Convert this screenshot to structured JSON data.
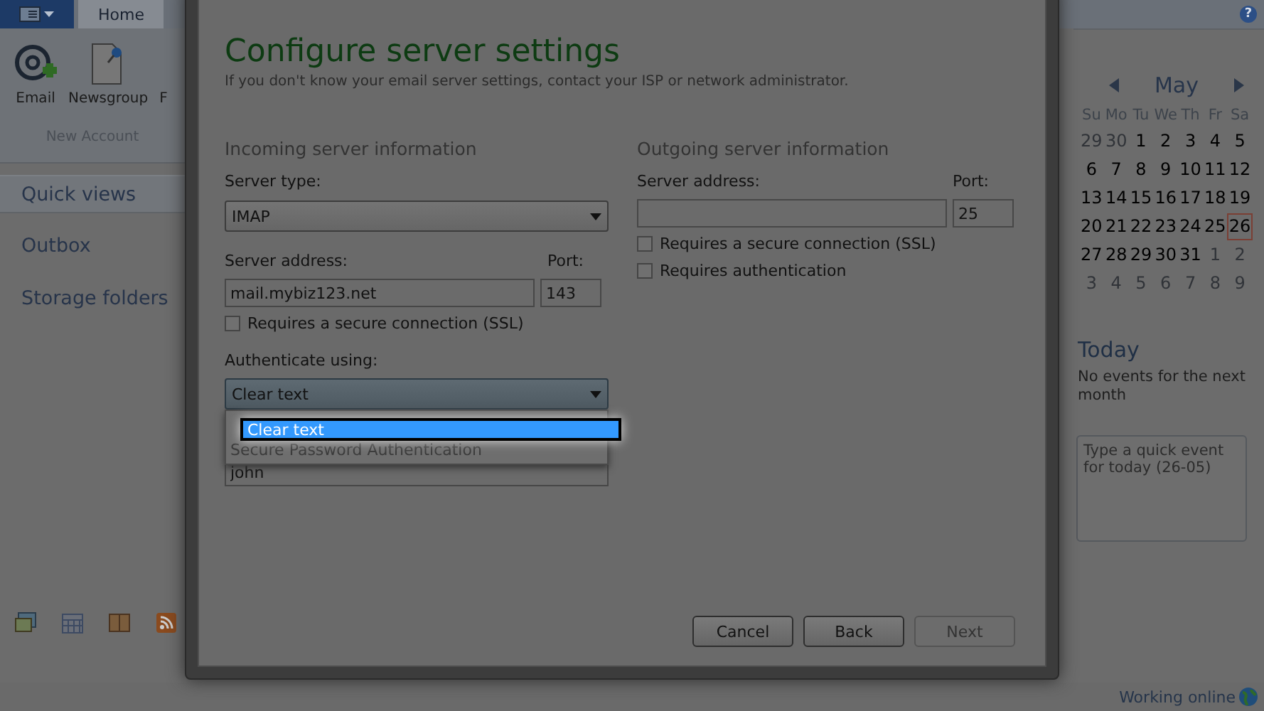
{
  "help": {
    "label": "?"
  },
  "ribbon": {
    "tabs": [
      {
        "label": "Home",
        "selected": true
      }
    ],
    "buttons": [
      {
        "kind": "email",
        "label": "Email"
      },
      {
        "kind": "newsgroup",
        "label": "Newsgroup"
      },
      {
        "kind": "cut",
        "label": "F"
      }
    ],
    "group_label": "New Account"
  },
  "nav": {
    "items": [
      {
        "label": "Quick views",
        "selected": true
      },
      {
        "label": "Outbox",
        "selected": false
      },
      {
        "label": "Storage folders",
        "selected": false
      }
    ]
  },
  "dialog": {
    "title": "Configure server settings",
    "subtitle": "If you don't know your email server settings, contact your ISP or network administrator.",
    "incoming": {
      "heading": "Incoming server information",
      "server_type": {
        "label": "Server type:",
        "value": "IMAP"
      },
      "server_address": {
        "label": "Server address:",
        "value": "mail.mybiz123.net"
      },
      "port": {
        "label": "Port:",
        "value": "143"
      },
      "secure": {
        "label": "Requires a secure connection (SSL)",
        "checked": false
      },
      "authenticate": {
        "label": "Authenticate using:",
        "value": "Clear text",
        "expanded": true,
        "options": [
          {
            "label": "Clear text",
            "selected": true
          },
          {
            "label": "Secure Password Authentication",
            "selected": false
          }
        ]
      },
      "username": {
        "value": "john"
      }
    },
    "outgoing": {
      "heading": "Outgoing server information",
      "server_address": {
        "label": "Server address:"
      },
      "port": {
        "label": "Port:",
        "value": "25"
      },
      "checkboxes": [
        {
          "label": "Requires a secure connection (SSL)",
          "checked": false
        },
        {
          "label": "Requires authentication",
          "checked": false
        }
      ]
    },
    "buttons": [
      {
        "label": "Cancel",
        "disabled": false
      },
      {
        "label": "Back",
        "disabled": false
      },
      {
        "label": "Next",
        "disabled": true
      }
    ]
  },
  "calendar": {
    "month": "May",
    "weekdays": [
      "Su",
      "Mo",
      "Tu",
      "We",
      "Th",
      "Fr",
      "Sa"
    ],
    "weeks": [
      [
        {
          "day": "29",
          "other_month": true,
          "selected": false
        },
        {
          "day": "30",
          "other_month": true,
          "selected": false
        },
        {
          "day": "1",
          "other_month": false,
          "selected": false
        },
        {
          "day": "2",
          "other_month": false,
          "selected": false
        },
        {
          "day": "3",
          "other_month": false,
          "selected": false
        },
        {
          "day": "4",
          "other_month": false,
          "selected": false
        },
        {
          "day": "5",
          "other_month": false,
          "selected": false
        }
      ],
      [
        {
          "day": "6",
          "other_month": false,
          "selected": false
        },
        {
          "day": "7",
          "other_month": false,
          "selected": false
        },
        {
          "day": "8",
          "other_month": false,
          "selected": false
        },
        {
          "day": "9",
          "other_month": false,
          "selected": false
        },
        {
          "day": "10",
          "other_month": false,
          "selected": false
        },
        {
          "day": "11",
          "other_month": false,
          "selected": false
        },
        {
          "day": "12",
          "other_month": false,
          "selected": false
        }
      ],
      [
        {
          "day": "13",
          "other_month": false,
          "selected": false
        },
        {
          "day": "14",
          "other_month": false,
          "selected": false
        },
        {
          "day": "15",
          "other_month": false,
          "selected": false
        },
        {
          "day": "16",
          "other_month": false,
          "selected": false
        },
        {
          "day": "17",
          "other_month": false,
          "selected": false
        },
        {
          "day": "18",
          "other_month": false,
          "selected": false
        },
        {
          "day": "19",
          "other_month": false,
          "selected": false
        }
      ],
      [
        {
          "day": "20",
          "other_month": false,
          "selected": false
        },
        {
          "day": "21",
          "other_month": false,
          "selected": false
        },
        {
          "day": "22",
          "other_month": false,
          "selected": false
        },
        {
          "day": "23",
          "other_month": false,
          "selected": false
        },
        {
          "day": "24",
          "other_month": false,
          "selected": false
        },
        {
          "day": "25",
          "other_month": false,
          "selected": false
        },
        {
          "day": "26",
          "other_month": false,
          "selected": true
        }
      ],
      [
        {
          "day": "27",
          "other_month": false,
          "selected": false
        },
        {
          "day": "28",
          "other_month": false,
          "selected": false
        },
        {
          "day": "29",
          "other_month": false,
          "selected": false
        },
        {
          "day": "30",
          "other_month": false,
          "selected": false
        },
        {
          "day": "31",
          "other_month": false,
          "selected": false
        },
        {
          "day": "1",
          "other_month": true,
          "selected": false
        },
        {
          "day": "2",
          "other_month": true,
          "selected": false
        }
      ],
      [
        {
          "day": "3",
          "other_month": true,
          "selected": false
        },
        {
          "day": "4",
          "other_month": true,
          "selected": false
        },
        {
          "day": "5",
          "other_month": true,
          "selected": false
        },
        {
          "day": "6",
          "other_month": true,
          "selected": false
        },
        {
          "day": "7",
          "other_month": true,
          "selected": false
        },
        {
          "day": "8",
          "other_month": true,
          "selected": false
        },
        {
          "day": "9",
          "other_month": true,
          "selected": false
        }
      ]
    ]
  },
  "today": {
    "title": "Today",
    "message": "No events for the next month",
    "quick_event": {
      "placeholder": "Type a quick event for today (26-05)"
    }
  },
  "status_bar": {
    "text": "Working online"
  }
}
